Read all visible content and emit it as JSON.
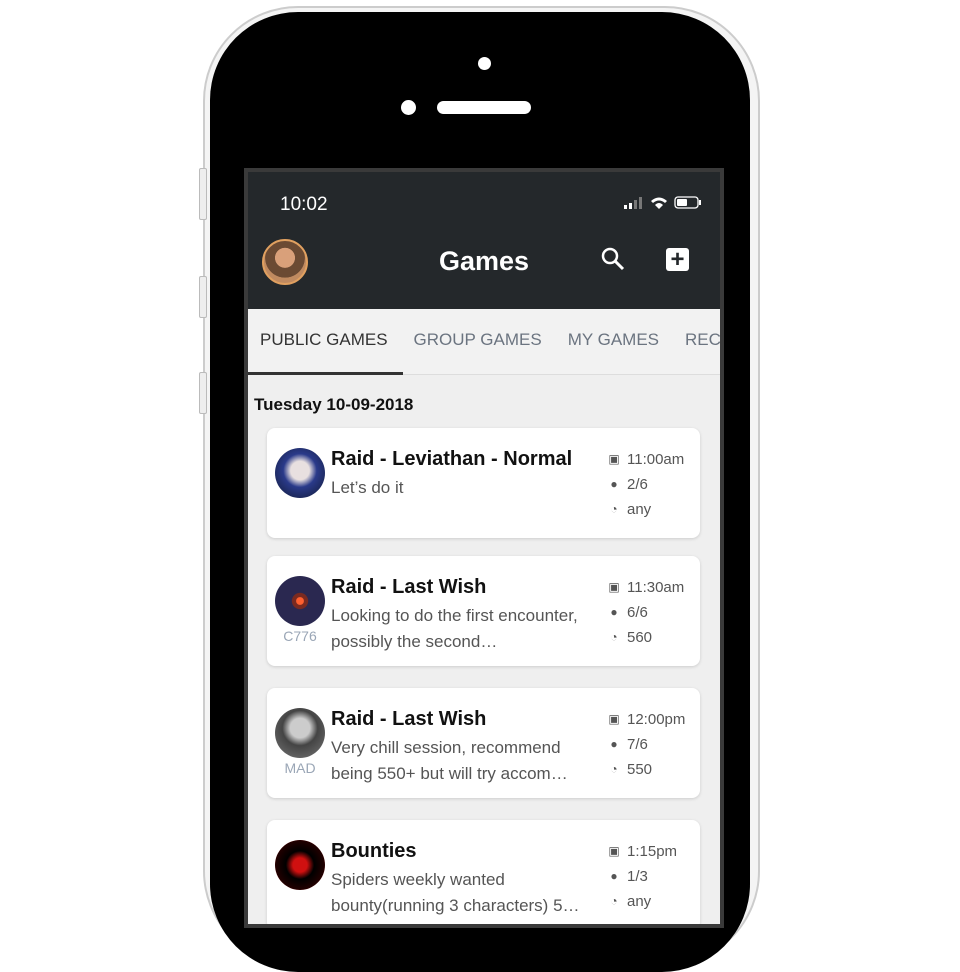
{
  "status": {
    "time": "10:02"
  },
  "header": {
    "title": "Games"
  },
  "tabs": [
    {
      "label": "PUBLIC GAMES"
    },
    {
      "label": "GROUP GAMES"
    },
    {
      "label": "MY GAMES"
    },
    {
      "label": "REC"
    }
  ],
  "date": "Tuesday 10-09-2018",
  "colors": {
    "header": "#24282b",
    "background": "#efefef"
  },
  "games": [
    {
      "title": "Raid - Leviathan - Normal",
      "desc": "Let’s do it",
      "tag": "",
      "time": "11:00am",
      "players": "2/6",
      "power": "any"
    },
    {
      "title": "Raid - Last Wish",
      "desc": "Looking to do the first encounter, possibly the second…",
      "tag": "C776",
      "time": "11:30am",
      "players": "6/6",
      "power": "560"
    },
    {
      "title": "Raid - Last Wish",
      "desc": "Very chill session, recommend being 550+ but will try accom…",
      "tag": "MAD",
      "time": "12:00pm",
      "players": "7/6",
      "power": "550"
    },
    {
      "title": "Bounties",
      "desc": "Spiders weekly wanted bounty(running 3 characters) 5…",
      "tag": "",
      "time": "1:15pm",
      "players": "1/3",
      "power": "any"
    }
  ]
}
